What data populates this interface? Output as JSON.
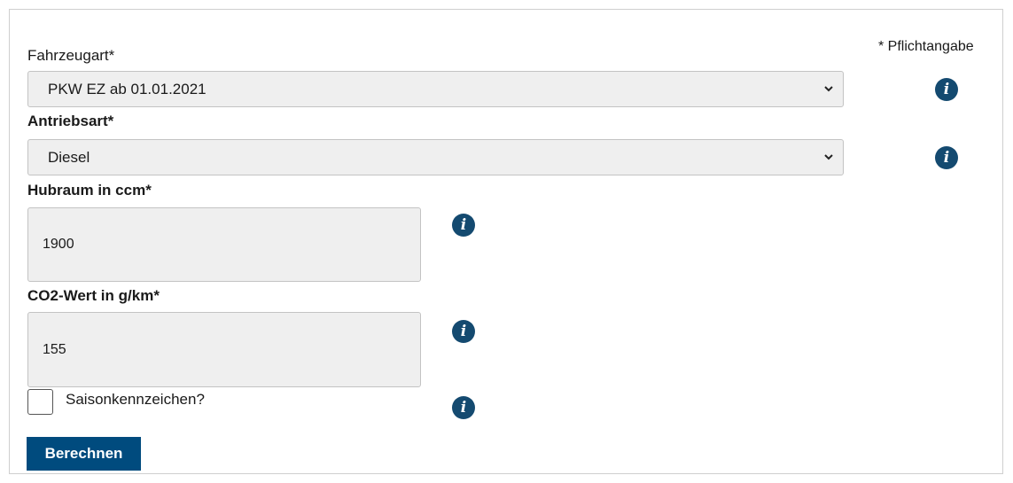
{
  "form": {
    "required_note": "* Pflichtangabe",
    "vehicle_type": {
      "label": "Fahrzeugart*",
      "value": "PKW EZ ab 01.01.2021"
    },
    "drive_type": {
      "label": "Antriebsart*",
      "value": "Diesel"
    },
    "displacement": {
      "label": "Hubraum in ccm*",
      "value": "1900"
    },
    "co2": {
      "label": "CO2-Wert in g/km*",
      "value": "155"
    },
    "seasonal_plate": {
      "label": "Saisonkennzeichen?",
      "checked": false
    },
    "submit_label": "Berechnen",
    "info_glyph": "i"
  },
  "icons": {
    "info": "info-icon",
    "dropdown": "chevron-down-icon"
  },
  "colors": {
    "accent": "#004b7e",
    "info_icon": "#144a70",
    "field_bg": "#efefef"
  }
}
